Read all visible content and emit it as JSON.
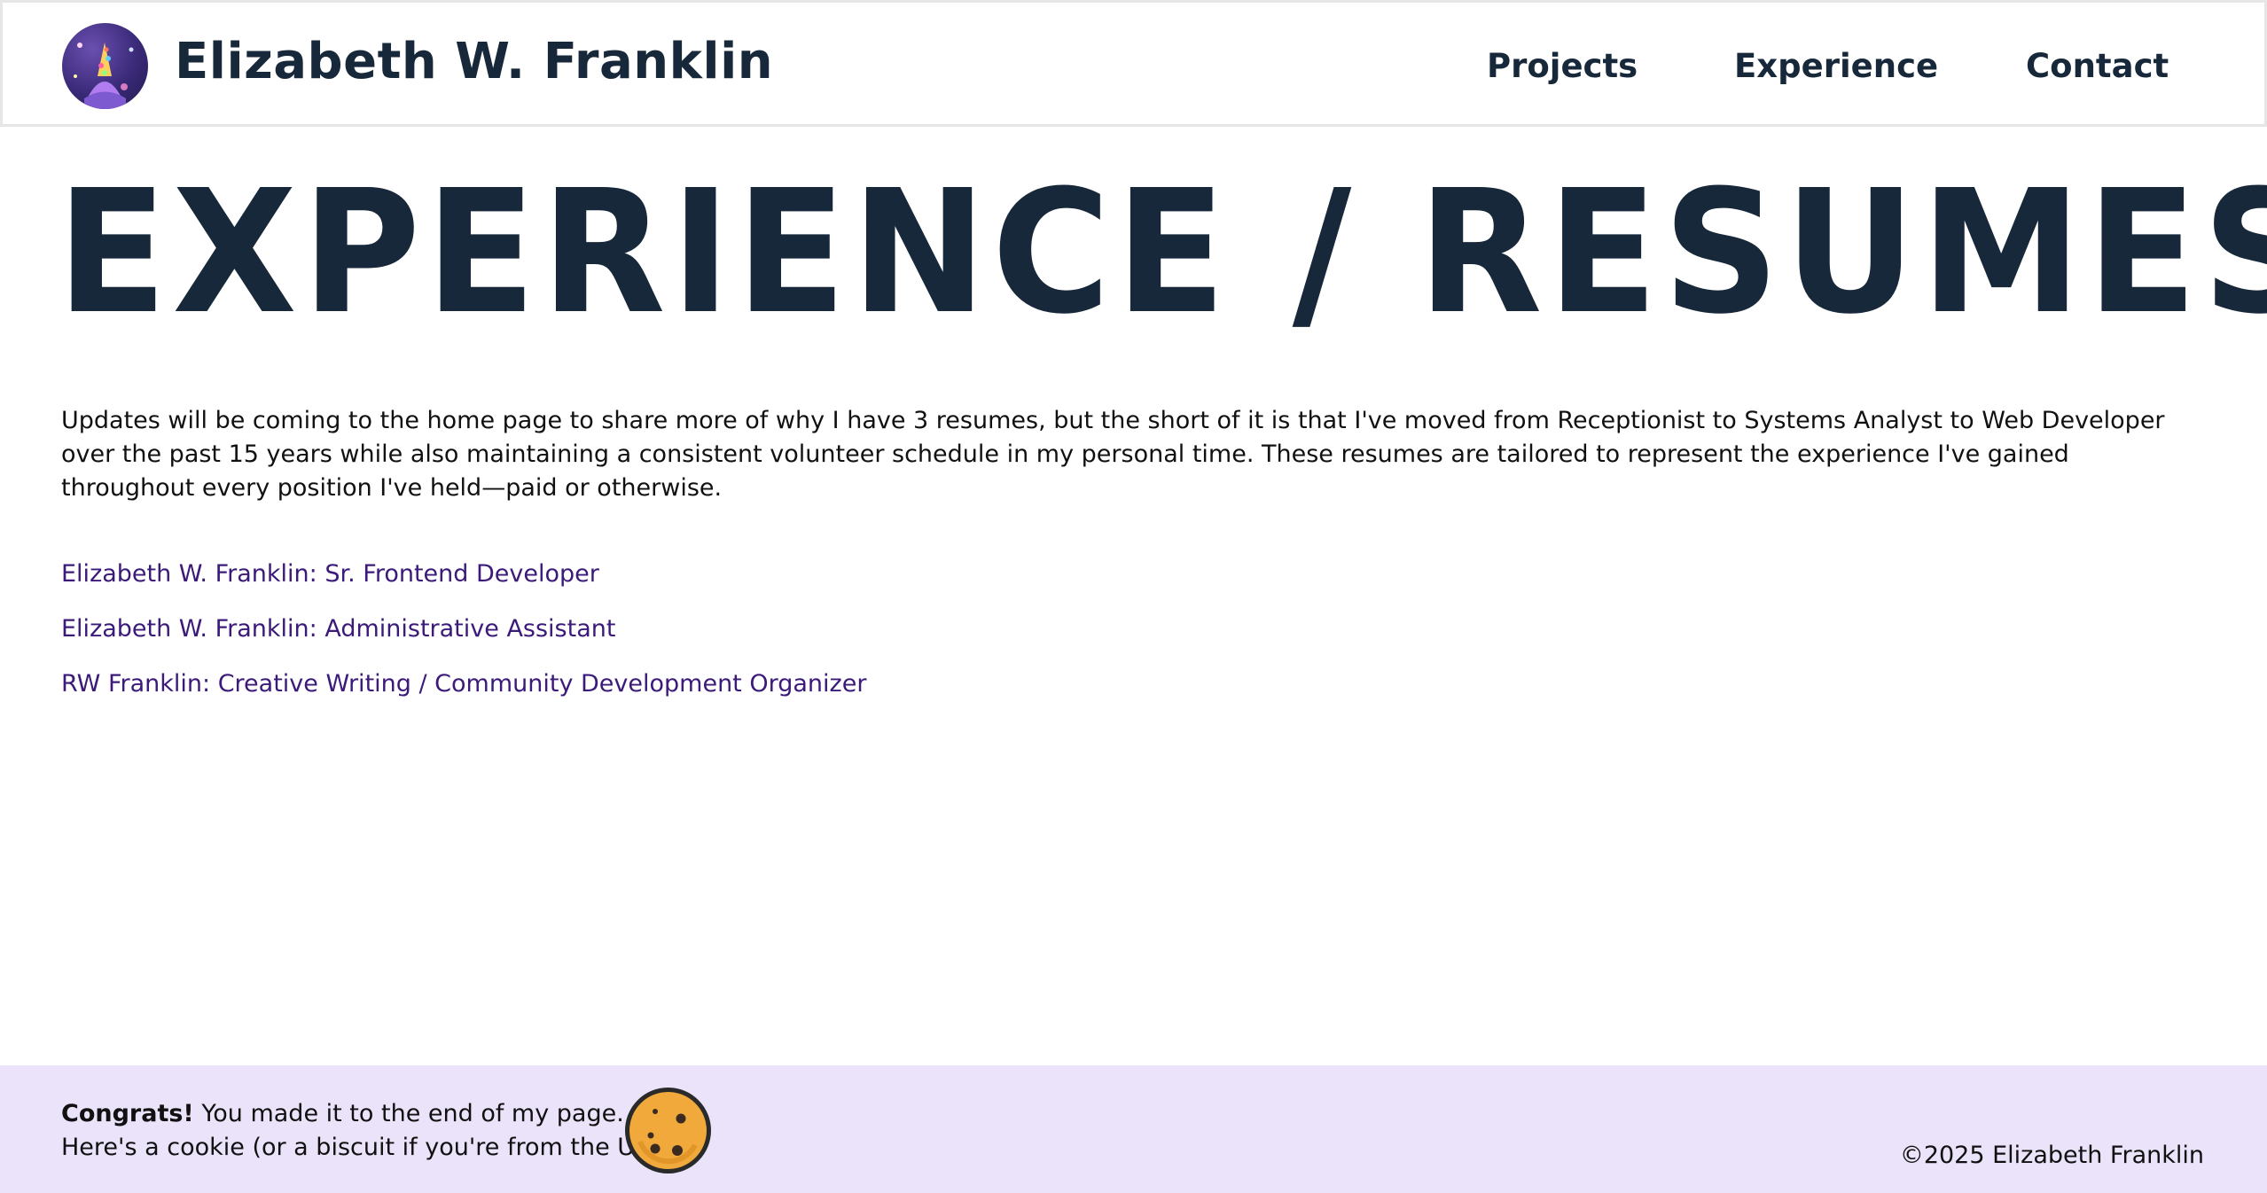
{
  "header": {
    "site_title": "Elizabeth W. Franklin",
    "nav": [
      {
        "label": "Projects"
      },
      {
        "label": "Experience"
      },
      {
        "label": "Contact"
      }
    ]
  },
  "main": {
    "heading": "EXPERIENCE / RESUMES",
    "intro": "Updates will be coming to the home page to share more of why I have 3 resumes, but the short of it is that I've moved from Receptionist to Systems Analyst to Web Developer over the past 15 years while also maintaining a consistent volunteer schedule in my personal time. These resumes are tailored to represent the experience I've gained throughout every position I've held—paid or otherwise.",
    "resume_links": [
      {
        "label": "Elizabeth W. Franklin: Sr. Frontend Developer"
      },
      {
        "label": "Elizabeth W. Franklin: Administrative Assistant"
      },
      {
        "label": "RW Franklin: Creative Writing / Community Development Organizer"
      }
    ]
  },
  "footer": {
    "congrats_bold": "Congrats!",
    "congrats_rest": " You made it to the end of my page.",
    "cookie_line": "Here's a cookie (or a biscuit if you're from the UK)!",
    "copyright": "©2025 Elizabeth Franklin"
  },
  "colors": {
    "primary_text": "#17283a",
    "link": "#3b1a79",
    "footer_bg": "#ebe3fa",
    "cookie": "#f0a93a"
  },
  "icons": {
    "avatar": "avatar-icon",
    "cookie": "cookie-icon"
  }
}
